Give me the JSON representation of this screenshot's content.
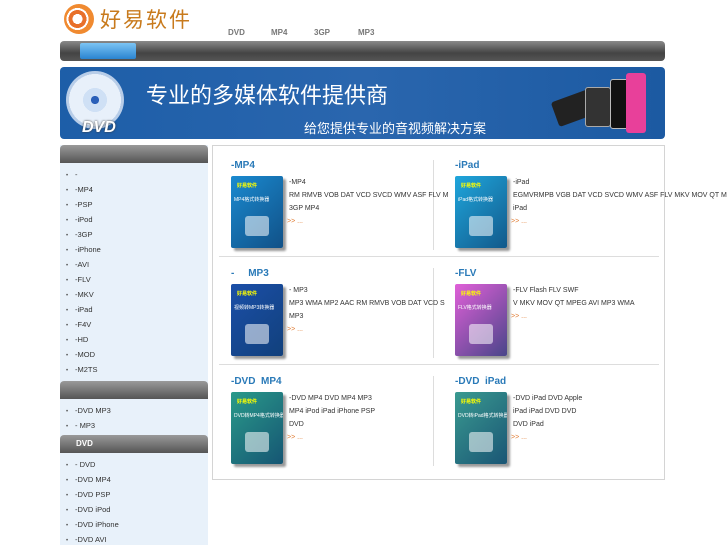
{
  "header": {
    "logo_text": "好易软件",
    "nav": [
      "DVD",
      "MP4",
      "3GP",
      "MP3"
    ]
  },
  "banner": {
    "title": "专业的多媒体软件提供商",
    "subtitle": "给您提供专业的音视频解决方案",
    "disc_label": "DVD"
  },
  "sidebar": {
    "sections": [
      {
        "title": "",
        "items": [
          "-",
          "-MP4",
          "-PSP",
          "-iPod",
          "-3GP",
          "-iPhone",
          "-AVI",
          "-FLV",
          "-MKV",
          "-iPad",
          "-F4V",
          "-HD",
          "-MOD",
          "-M2TS"
        ]
      },
      {
        "title": "",
        "items": [
          "-DVD MP3",
          "-  MP3"
        ]
      },
      {
        "title": "DVD",
        "items": [
          "-  DVD",
          "-DVD MP4",
          "-DVD PSP",
          "-DVD iPod",
          "-DVD iPhone",
          "-DVD AVI"
        ]
      }
    ]
  },
  "products": [
    {
      "title": "-MP4",
      "box_brand": "好易软件",
      "box_name": "MP4格式转换器",
      "color": "#1a8ad0",
      "lines": [
        "-MP4",
        "RM RMVB VOB DAT VCD SVCD WMV ASF FLV M",
        "3GP MP4"
      ],
      "more": ">>   ..."
    },
    {
      "title": "-iPad",
      "box_brand": "好易软件",
      "box_name": "iPad格式转换器",
      "color": "#1fa6dc",
      "lines": [
        "-iPad",
        "EGMVRMPB VGB DAT VCD SVCD WMV ASF FLV MKV MOV QT M",
        "iPad"
      ],
      "more": ">>   ..."
    },
    {
      "title": "-     MP3",
      "box_brand": "好易软件",
      "box_name": "视频转MP3转换器",
      "color": "#1b4fa8",
      "lines": [
        "-   MP3",
        "MP3 WMA MP2 AAC RM RMVB VOB DAT VCD S",
        " MP3"
      ],
      "more": ">>   ..."
    },
    {
      "title": "-FLV",
      "box_brand": "好易软件",
      "box_name": "FLV格式转换器",
      "color": "#e060d8",
      "lines": [
        "-FLV                      Flash FLV SWF",
        "V MKV MOV QT MPEG AVI MP3 WMA"
      ],
      "more": ">>   ..."
    },
    {
      "title": "-DVD  MP4",
      "box_brand": "好易软件",
      "box_name": "DVD转MP4格式转换器",
      "color": "#2a9a8a",
      "lines": [
        "-DVD MP4                DVD    MP4 MP3",
        "           MP4    iPod iPad iPhone PSP",
        "    DVD"
      ],
      "more": ">>   ..."
    },
    {
      "title": "-DVD  iPad",
      "box_brand": "好易软件",
      "box_name": "DVD转iPad格式转换器",
      "color": "#3a9a90",
      "lines": [
        "-DVD iPad               DVD     Apple",
        "iPad           iPad      DVD     DVD",
        "DVD iPad"
      ],
      "more": ">>   ..."
    }
  ]
}
